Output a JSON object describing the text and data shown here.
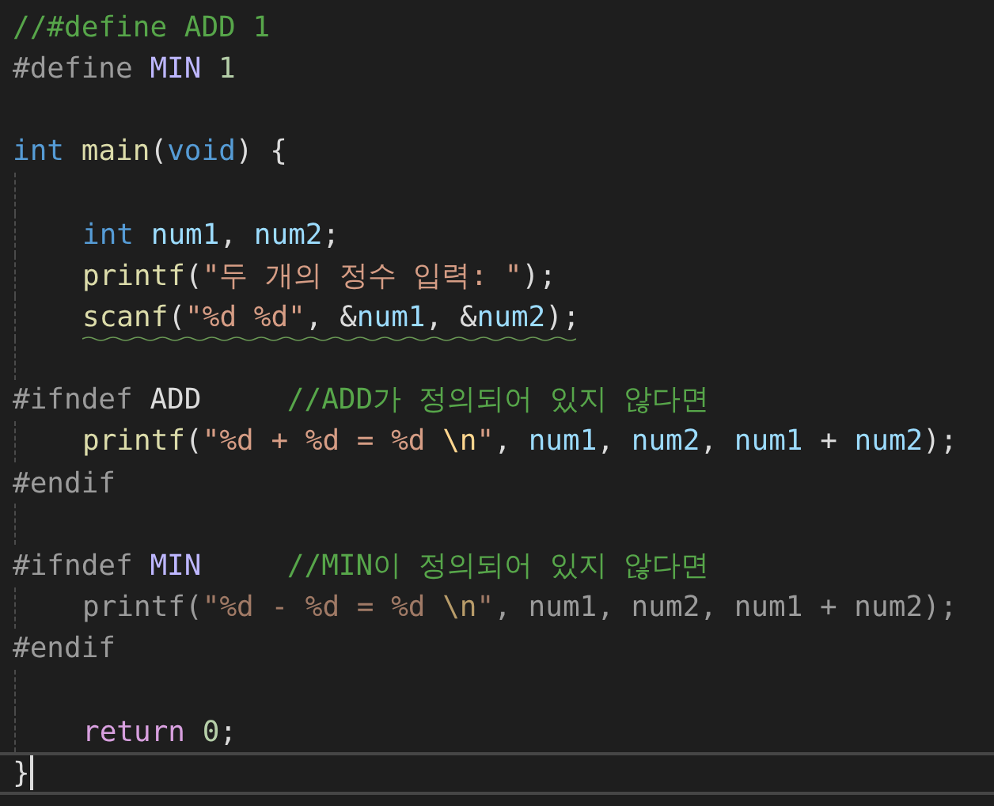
{
  "editor": {
    "lines": [
      {
        "kind": "code",
        "tokens": [
          {
            "kind": "comment",
            "text": "//#define ADD 1"
          }
        ]
      },
      {
        "kind": "code",
        "tokens": [
          {
            "kind": "preproc",
            "text": "#define "
          },
          {
            "kind": "macro",
            "text": "MIN"
          },
          {
            "kind": "number",
            "text": " 1"
          }
        ]
      },
      {
        "kind": "blank"
      },
      {
        "kind": "code",
        "tokens": [
          {
            "kind": "keyword",
            "text": "int "
          },
          {
            "kind": "function",
            "text": "main"
          },
          {
            "kind": "plain",
            "text": "("
          },
          {
            "kind": "keyword",
            "text": "void"
          },
          {
            "kind": "plain",
            "text": ") {"
          }
        ]
      },
      {
        "kind": "blank",
        "guide": true
      },
      {
        "kind": "code",
        "guide": true,
        "indented": true,
        "tokens": [
          {
            "kind": "keyword",
            "text": "int "
          },
          {
            "kind": "variable",
            "text": "num1"
          },
          {
            "kind": "plain",
            "text": ", "
          },
          {
            "kind": "variable",
            "text": "num2"
          },
          {
            "kind": "plain",
            "text": ";"
          }
        ]
      },
      {
        "kind": "code",
        "guide": true,
        "indented": true,
        "tokens": [
          {
            "kind": "function",
            "text": "printf"
          },
          {
            "kind": "plain",
            "text": "("
          },
          {
            "kind": "string",
            "text": "\"두 개의 정수 입력: \""
          },
          {
            "kind": "plain",
            "text": ");"
          }
        ]
      },
      {
        "kind": "code",
        "guide": true,
        "indented": true,
        "squiggle": true,
        "tokens": [
          {
            "kind": "function",
            "text": "scanf"
          },
          {
            "kind": "plain",
            "text": "("
          },
          {
            "kind": "string",
            "text": "\"%d %d\""
          },
          {
            "kind": "plain",
            "text": ", &"
          },
          {
            "kind": "variable",
            "text": "num1"
          },
          {
            "kind": "plain",
            "text": ", &"
          },
          {
            "kind": "variable",
            "text": "num2"
          },
          {
            "kind": "plain",
            "text": ");"
          }
        ]
      },
      {
        "kind": "blank",
        "guide": true
      },
      {
        "kind": "code",
        "tokens": [
          {
            "kind": "preproc",
            "text": "#ifndef "
          },
          {
            "kind": "plain",
            "text": "ADD     "
          },
          {
            "kind": "comment",
            "text": "//ADD가 정의되어 있지 않다면"
          }
        ]
      },
      {
        "kind": "code",
        "guide": true,
        "indented": true,
        "tokens": [
          {
            "kind": "function",
            "text": "printf"
          },
          {
            "kind": "plain",
            "text": "("
          },
          {
            "kind": "string",
            "text": "\"%d + %d = %d "
          },
          {
            "kind": "escape",
            "text": "\\n"
          },
          {
            "kind": "string",
            "text": "\""
          },
          {
            "kind": "plain",
            "text": ", "
          },
          {
            "kind": "variable",
            "text": "num1"
          },
          {
            "kind": "plain",
            "text": ", "
          },
          {
            "kind": "variable",
            "text": "num2"
          },
          {
            "kind": "plain",
            "text": ", "
          },
          {
            "kind": "variable",
            "text": "num1"
          },
          {
            "kind": "plain",
            "text": " + "
          },
          {
            "kind": "variable",
            "text": "num2"
          },
          {
            "kind": "plain",
            "text": ");"
          }
        ]
      },
      {
        "kind": "code",
        "tokens": [
          {
            "kind": "preproc",
            "text": "#endif"
          }
        ]
      },
      {
        "kind": "blank",
        "guide": true
      },
      {
        "kind": "code",
        "tokens": [
          {
            "kind": "preproc",
            "text": "#ifndef "
          },
          {
            "kind": "macro",
            "text": "MIN     "
          },
          {
            "kind": "comment",
            "text": "//MIN이 정의되어 있지 않다면"
          }
        ]
      },
      {
        "kind": "code",
        "guide": true,
        "indented": true,
        "inactive": true,
        "tokens": [
          {
            "kind": "plain",
            "text": "printf("
          },
          {
            "kind": "string",
            "text": "\"%d - %d = %d "
          },
          {
            "kind": "escape",
            "text": "\\n"
          },
          {
            "kind": "string",
            "text": "\""
          },
          {
            "kind": "plain",
            "text": ", num1, num2, num1 + num2);"
          }
        ]
      },
      {
        "kind": "code",
        "tokens": [
          {
            "kind": "preproc",
            "text": "#endif"
          }
        ]
      },
      {
        "kind": "blank",
        "guide": true
      },
      {
        "kind": "code",
        "guide": true,
        "indented": true,
        "tokens": [
          {
            "kind": "control",
            "text": "return "
          },
          {
            "kind": "number",
            "text": "0"
          },
          {
            "kind": "plain",
            "text": ";"
          }
        ]
      },
      {
        "kind": "code",
        "current": true,
        "tokens": [
          {
            "kind": "plain",
            "text": "}"
          }
        ]
      }
    ]
  }
}
